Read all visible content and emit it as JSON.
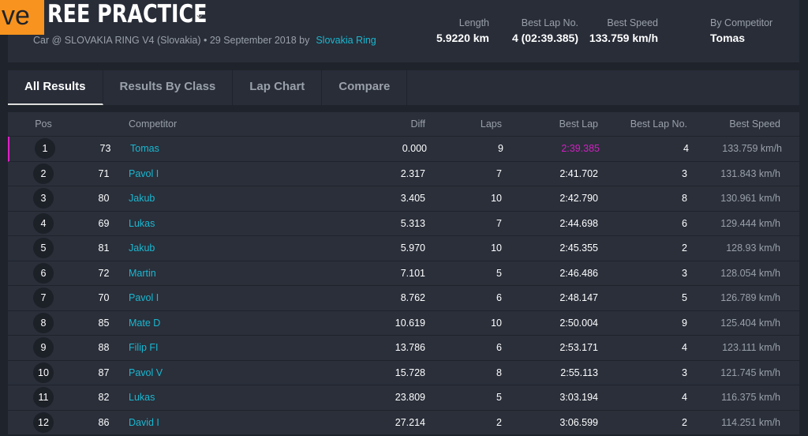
{
  "logo_text": "ve",
  "header": {
    "title": "REE PRACTICE",
    "subtitle": "Car @ SLOVAKIA RING V4 (Slovakia) • 29 September 2018 by",
    "organizer_link": "Slovakia Ring"
  },
  "stats": [
    {
      "label": "Length",
      "value": "5.9220 km"
    },
    {
      "label": "Best Lap No.",
      "value": "4 (02:39.385)"
    },
    {
      "label": "Best Speed",
      "value": "133.759 km/h"
    },
    {
      "label": "By Competitor",
      "value": "Tomas"
    }
  ],
  "tabs": [
    "All Results",
    "Results By Class",
    "Lap Chart",
    "Compare"
  ],
  "columns": {
    "pos": "Pos",
    "competitor": "Competitor",
    "diff": "Diff",
    "laps": "Laps",
    "best_lap": "Best Lap",
    "best_lap_no": "Best Lap No.",
    "best_speed": "Best Speed"
  },
  "rows": [
    {
      "pos": "1",
      "num": "73",
      "name": "Tomas",
      "diff": "0.000",
      "laps": "9",
      "best_lap": "2:39.385",
      "best_lap_no": "4",
      "best_speed": "133.759 km/h"
    },
    {
      "pos": "2",
      "num": "71",
      "name": "Pavol I",
      "diff": "2.317",
      "laps": "7",
      "best_lap": "2:41.702",
      "best_lap_no": "3",
      "best_speed": "131.843 km/h"
    },
    {
      "pos": "3",
      "num": "80",
      "name": "Jakub",
      "diff": "3.405",
      "laps": "10",
      "best_lap": "2:42.790",
      "best_lap_no": "8",
      "best_speed": "130.961 km/h"
    },
    {
      "pos": "4",
      "num": "69",
      "name": "Lukas",
      "diff": "5.313",
      "laps": "7",
      "best_lap": "2:44.698",
      "best_lap_no": "6",
      "best_speed": "129.444 km/h"
    },
    {
      "pos": "5",
      "num": "81",
      "name": "Jakub",
      "diff": "5.970",
      "laps": "10",
      "best_lap": "2:45.355",
      "best_lap_no": "2",
      "best_speed": "128.93 km/h"
    },
    {
      "pos": "6",
      "num": "72",
      "name": "Martin",
      "diff": "7.101",
      "laps": "5",
      "best_lap": "2:46.486",
      "best_lap_no": "3",
      "best_speed": "128.054 km/h"
    },
    {
      "pos": "7",
      "num": "70",
      "name": "Pavol I",
      "diff": "8.762",
      "laps": "6",
      "best_lap": "2:48.147",
      "best_lap_no": "5",
      "best_speed": "126.789 km/h"
    },
    {
      "pos": "8",
      "num": "85",
      "name": "Mate D",
      "diff": "10.619",
      "laps": "10",
      "best_lap": "2:50.004",
      "best_lap_no": "9",
      "best_speed": "125.404 km/h"
    },
    {
      "pos": "9",
      "num": "88",
      "name": "Filip FI",
      "diff": "13.786",
      "laps": "6",
      "best_lap": "2:53.171",
      "best_lap_no": "4",
      "best_speed": "123.111 km/h"
    },
    {
      "pos": "10",
      "num": "87",
      "name": "Pavol V",
      "diff": "15.728",
      "laps": "8",
      "best_lap": "2:55.113",
      "best_lap_no": "3",
      "best_speed": "121.745 km/h"
    },
    {
      "pos": "11",
      "num": "82",
      "name": "Lukas",
      "diff": "23.809",
      "laps": "5",
      "best_lap": "3:03.194",
      "best_lap_no": "4",
      "best_speed": "116.375 km/h"
    },
    {
      "pos": "12",
      "num": "86",
      "name": "David I",
      "diff": "27.214",
      "laps": "2",
      "best_lap": "3:06.599",
      "best_lap_no": "2",
      "best_speed": "114.251 km/h"
    }
  ]
}
